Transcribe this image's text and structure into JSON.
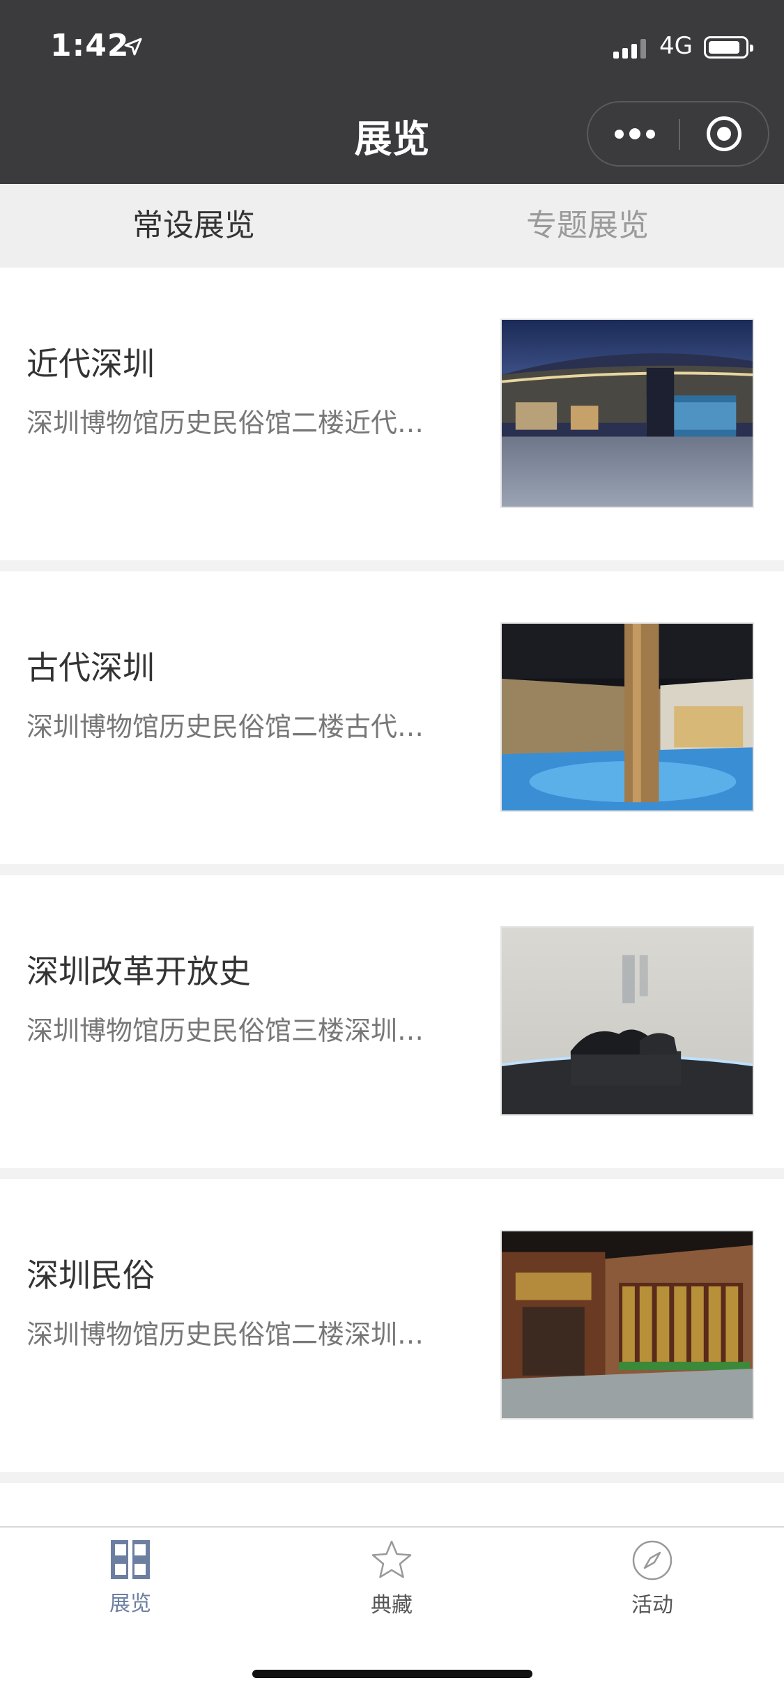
{
  "status_bar": {
    "time": "1:42",
    "network": "4G"
  },
  "nav": {
    "title": "展览"
  },
  "tabs": [
    {
      "label": "常设展览",
      "active": true
    },
    {
      "label": "专题展览",
      "active": false
    }
  ],
  "exhibitions": [
    {
      "title": "近代深圳",
      "desc": "深圳博物馆历史民俗馆二楼近代…"
    },
    {
      "title": "古代深圳",
      "desc": "深圳博物馆历史民俗馆二楼古代…"
    },
    {
      "title": "深圳改革开放史",
      "desc": "深圳博物馆历史民俗馆三楼深圳…"
    },
    {
      "title": "深圳民俗",
      "desc": "深圳博物馆历史民俗馆二楼深圳…"
    }
  ],
  "tabbar": {
    "items": [
      {
        "label": "展览",
        "icon": "exhibition-icon",
        "active": true
      },
      {
        "label": "典藏",
        "icon": "star-icon",
        "active": false
      },
      {
        "label": "活动",
        "icon": "compass-icon",
        "active": false
      }
    ]
  },
  "colors": {
    "header_bg": "#3b3b3d",
    "tab_active": "#6d7fa1",
    "tab_strip_bg": "#efefef"
  }
}
